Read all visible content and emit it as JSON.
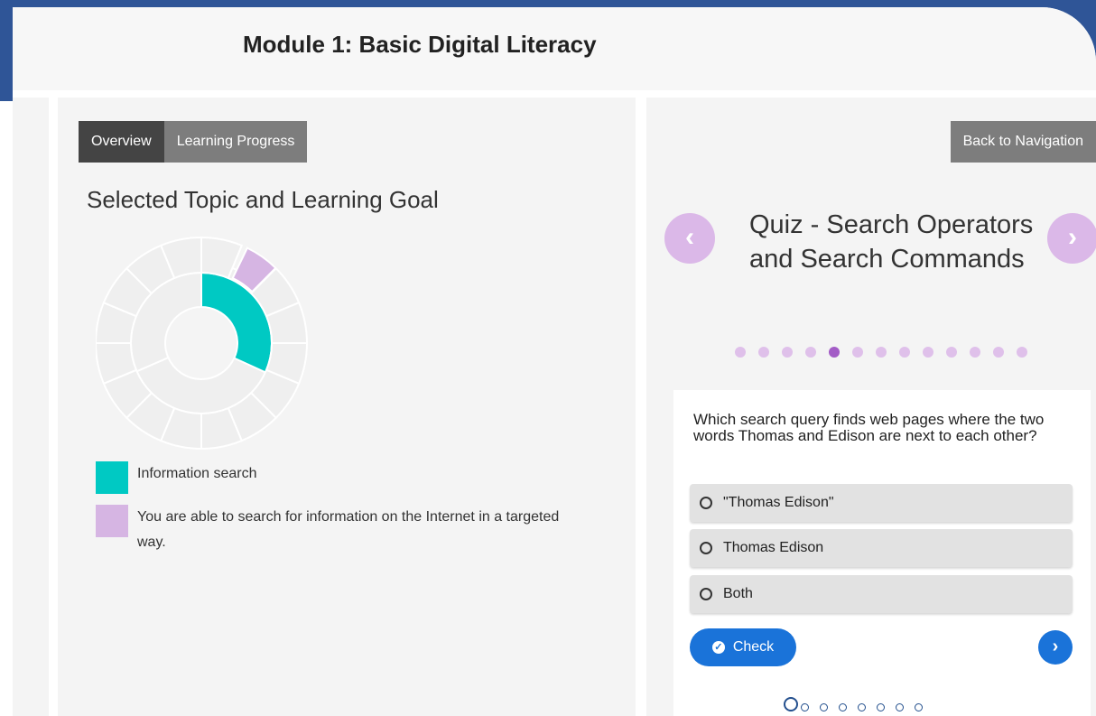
{
  "header": {
    "title": "Module 1: Basic Digital Literacy"
  },
  "tabs": [
    {
      "label": "Overview",
      "active": true
    },
    {
      "label": "Learning Progress",
      "active": false
    }
  ],
  "left_panel": {
    "heading": "Selected Topic and Learning Goal",
    "legend": [
      {
        "color": "#00c9c3",
        "label": "Information search"
      },
      {
        "color": "#d6b5e3",
        "label": "You are able to search for information on the Internet in a targeted way."
      }
    ]
  },
  "right_panel": {
    "back_label": "Back to Navigation",
    "prev_icon": "chevron-left-icon",
    "next_icon": "chevron-right-icon",
    "quiz_title": "Quiz - Search Operators and Search Commands",
    "slide_count": 13,
    "active_slide": 5,
    "question": "Which search query finds web pages where the two words Thomas and Edison are next to each other?",
    "options": [
      {
        "label": "\"Thomas Edison\""
      },
      {
        "label": "Thomas Edison"
      },
      {
        "label": "Both"
      }
    ],
    "check_label": "Check",
    "question_count": 8,
    "active_question": 1
  },
  "colors": {
    "accent_teal": "#00c9c3",
    "accent_purple": "#d6b5e3",
    "primary_blue": "#1a73d9",
    "frame_blue": "#2f5597"
  }
}
